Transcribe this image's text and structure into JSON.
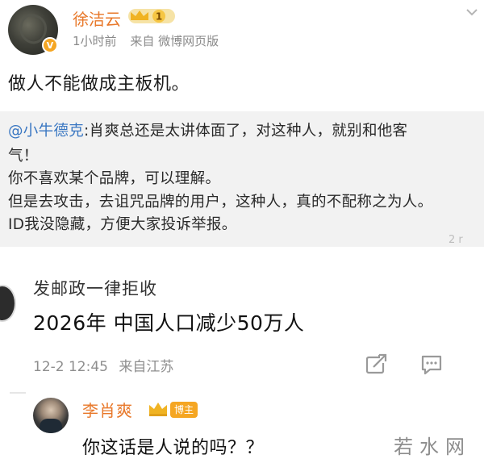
{
  "post": {
    "author": "徐洁云",
    "level": "1",
    "time": "1小时前",
    "source": "来自 微博网页版",
    "text": "做人不能做成主板机。"
  },
  "quote": {
    "mention": "@小牛德克",
    "lines": [
      ":肖爽总还是太讲体面了，对这种人，就别和他客",
      "气！",
      "你不喜欢某个品牌，可以理解。",
      "但是去攻击，去诅咒品牌的用户，这种人，真的不配称之为人。",
      "ID我没隐藏，方便大家投诉举报。"
    ],
    "cutoff": "2 r"
  },
  "comment": {
    "author": "发邮政一律拒收",
    "text": "2026年 中国人口减少50万人",
    "date": "12-2 12:45",
    "location": "来自江苏"
  },
  "reply": {
    "author": "李肖爽",
    "tag": "博主",
    "text": "你这话是人说的吗？？"
  },
  "watermark": "若水网",
  "colors": {
    "name_orange": "#e8782a",
    "mention_blue": "#3a77c2",
    "badge_gold": "#f5a623"
  },
  "icons": [
    "verified-badge-icon",
    "crown-icon",
    "share-icon",
    "comment-icon",
    "more-arrow-icon"
  ]
}
